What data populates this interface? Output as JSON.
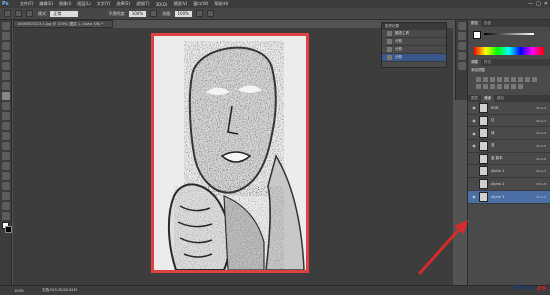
{
  "app": {
    "logo": "Ps"
  },
  "menu": [
    "文件(F)",
    "编辑(E)",
    "图像(I)",
    "图层(L)",
    "文字(Y)",
    "选择(S)",
    "滤镜(T)",
    "3D(D)",
    "视图(V)",
    "窗口(W)",
    "帮助(H)"
  ],
  "window_buttons": [
    "—",
    "□",
    "✕"
  ],
  "options_bar": {
    "mode_label": "模式:",
    "mode_value": "正常",
    "opacity_label": "不透明度:",
    "opacity_value": "100%",
    "flow_label": "流量:",
    "flow_value": "100%"
  },
  "document_tab": {
    "title": "16090503213-1.jpg @ 100% (图层 1, Alpha 3/8) *"
  },
  "history_panel": {
    "title": "历史记录",
    "items": [
      {
        "label": "圆选工具"
      },
      {
        "label": "分割"
      },
      {
        "label": "分割"
      },
      {
        "label": "分割"
      }
    ]
  },
  "right_panel": {
    "swatch_tabs": [
      "颜色",
      "色板"
    ],
    "adjust_tabs": [
      "调整",
      "样式"
    ],
    "adjust_title": "添加调整",
    "channel_tabs": [
      "图层",
      "通道",
      "路径"
    ],
    "channels": [
      {
        "name": "RGB",
        "key": "Ctrl+2",
        "visible": true,
        "selected": false
      },
      {
        "name": "红",
        "key": "Ctrl+3",
        "visible": true,
        "selected": false
      },
      {
        "name": "绿",
        "key": "Ctrl+4",
        "visible": true,
        "selected": false
      },
      {
        "name": "蓝",
        "key": "Ctrl+5",
        "visible": true,
        "selected": false
      },
      {
        "name": "蓝 副本",
        "key": "Ctrl+6",
        "visible": false,
        "selected": false
      },
      {
        "name": "Alpha 1",
        "key": "Ctrl+7",
        "visible": false,
        "selected": false
      },
      {
        "name": "Alpha 2",
        "key": "Ctrl+8",
        "visible": false,
        "selected": false
      },
      {
        "name": "Alpha 3",
        "key": "Ctrl+9",
        "visible": true,
        "selected": true
      }
    ]
  },
  "status_bar": {
    "zoom": "100%",
    "doc_info": "文档:925.2K/25.61M"
  },
  "watermark": {
    "part1": "Photo",
    "part2": "ps"
  },
  "colors": {
    "accent_select": "#4a6fa5",
    "highlight_border": "#e14040",
    "arrow": "#d62b2b"
  }
}
